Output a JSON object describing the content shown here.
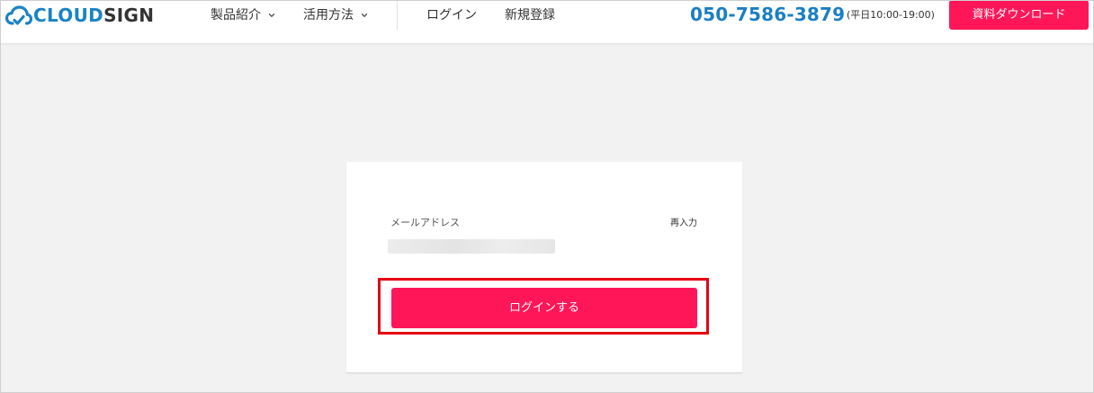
{
  "header": {
    "logo": {
      "part1": "CLOUD",
      "part2": "SIGN"
    },
    "nav": [
      {
        "label": "製品紹介",
        "has_dropdown": true
      },
      {
        "label": "活用方法",
        "has_dropdown": true
      },
      {
        "label": "ログイン",
        "has_dropdown": false
      },
      {
        "label": "新規登録",
        "has_dropdown": false
      }
    ],
    "phone": "050-7586-3879",
    "hours": "(平日10:00-19:00)",
    "download_label": "資料ダウンロード"
  },
  "login_card": {
    "email_label": "メールアドレス",
    "reenter_label": "再入力",
    "submit_label": "ログインする"
  },
  "colors": {
    "brand_blue": "#1a83c6",
    "accent_pink": "#ff1658",
    "highlight_red": "#e60012",
    "background": "#f2f2f2"
  },
  "icons": {
    "logo": "cloud-logo-icon",
    "dropdown": "chevron-down-icon"
  }
}
